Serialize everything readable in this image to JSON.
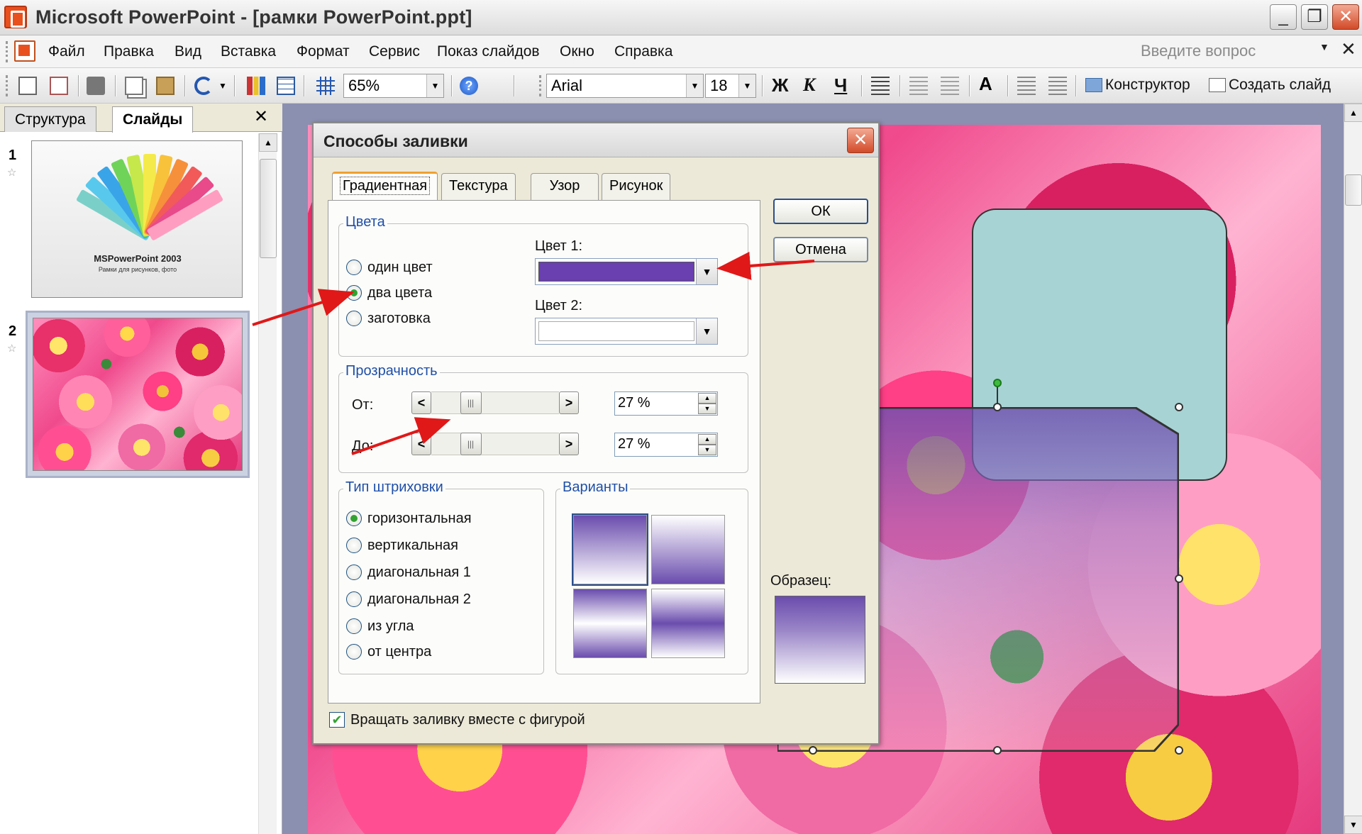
{
  "window": {
    "title": "Microsoft PowerPoint - [рамки PowerPoint.ppt]",
    "minimize": "_",
    "maximize": "❐",
    "close": "✕"
  },
  "menu": {
    "items": [
      "Файл",
      "Правка",
      "Вид",
      "Вставка",
      "Формат",
      "Сервис",
      "Показ слайдов",
      "Окно",
      "Справка"
    ],
    "help_placeholder": "Введите вопрос",
    "help_dropdown": "▼",
    "close": "✕"
  },
  "toolbar": {
    "zoom": "65%",
    "font": "Arial",
    "font_size": "18",
    "bold": "Ж",
    "italic": "К",
    "underline": "Ч",
    "font_grow": "A",
    "designer": "Конструктор",
    "new_slide": "Создать слайд",
    "dropdown_arrow": "▼"
  },
  "left_pane": {
    "tabs": [
      "Структура",
      "Слайды"
    ],
    "active_tab": "Слайды",
    "close": "✕",
    "slides": [
      {
        "number": "1",
        "title": "MSPowerPoint 2003",
        "subtitle": "Рамки для рисунков, фото"
      },
      {
        "number": "2"
      }
    ],
    "star": "☆",
    "scroll_up": "▲"
  },
  "slide_pane": {
    "scroll_up": "▲",
    "scroll_down": "▼"
  },
  "dialog": {
    "title": "Способы заливки",
    "close": "✕",
    "tabs": [
      "Градиентная",
      "Текстура",
      "Узор",
      "Рисунок"
    ],
    "active_tab": "Градиентная",
    "colors_group": {
      "label": "Цвета",
      "options": [
        "один цвет",
        "два цвета",
        "заготовка"
      ],
      "selected": "два цвета",
      "color1_label": "Цвет 1:",
      "color1_value": "#6a3fb0",
      "color2_label": "Цвет 2:",
      "color2_value": "#ffffff",
      "dropdown": "▼"
    },
    "transparency_group": {
      "label": "Прозрачность",
      "from_label": "От:",
      "from_value": "27 %",
      "from_fraction": 0.27,
      "to_label": "До:",
      "to_value": "27 %",
      "to_fraction": 0.27,
      "left": "<",
      "right": ">",
      "up": "▲",
      "down": "▼",
      "grip": "|||"
    },
    "shading_group": {
      "label": "Тип штриховки",
      "options": [
        "горизонтальная",
        "вертикальная",
        "диагональная 1",
        "диагональная 2",
        "из угла",
        "от центра"
      ],
      "selected": "горизонтальная"
    },
    "variants_group": {
      "label": "Варианты"
    },
    "sample_label": "Образец:",
    "ok_label": "ОК",
    "cancel_label": "Отмена",
    "rotate_checkbox": {
      "label": "Вращать заливку вместе с фигурой",
      "checked": true,
      "mark": "✔"
    }
  }
}
